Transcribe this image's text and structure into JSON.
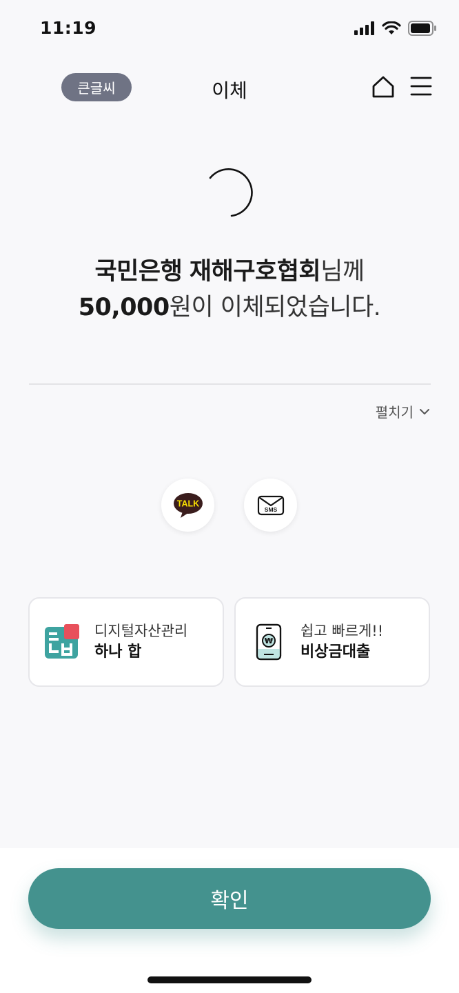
{
  "status_bar": {
    "time": "11:19"
  },
  "header": {
    "bigfont_label": "큰글씨",
    "title": "이체"
  },
  "message": {
    "bank": "국민은행",
    "recipient": "재해구호협회",
    "honorific": "님께",
    "amount": "50,000",
    "suffix_won": "원이 이체되었습니다."
  },
  "expand_label": "펼치기",
  "share": {
    "kakao_label": "TALK",
    "sms_label": "SMS"
  },
  "cards": [
    {
      "sub": "디지털자산관리",
      "main": "하나 합"
    },
    {
      "sub": "쉽고 빠르게!!",
      "main": "비상금대출"
    }
  ],
  "confirm_label": "확인",
  "colors": {
    "accent": "#44928e",
    "badge": "#6f7384",
    "kakao_bubble": "#3a1d1d",
    "kakao_text": "#fae100"
  }
}
